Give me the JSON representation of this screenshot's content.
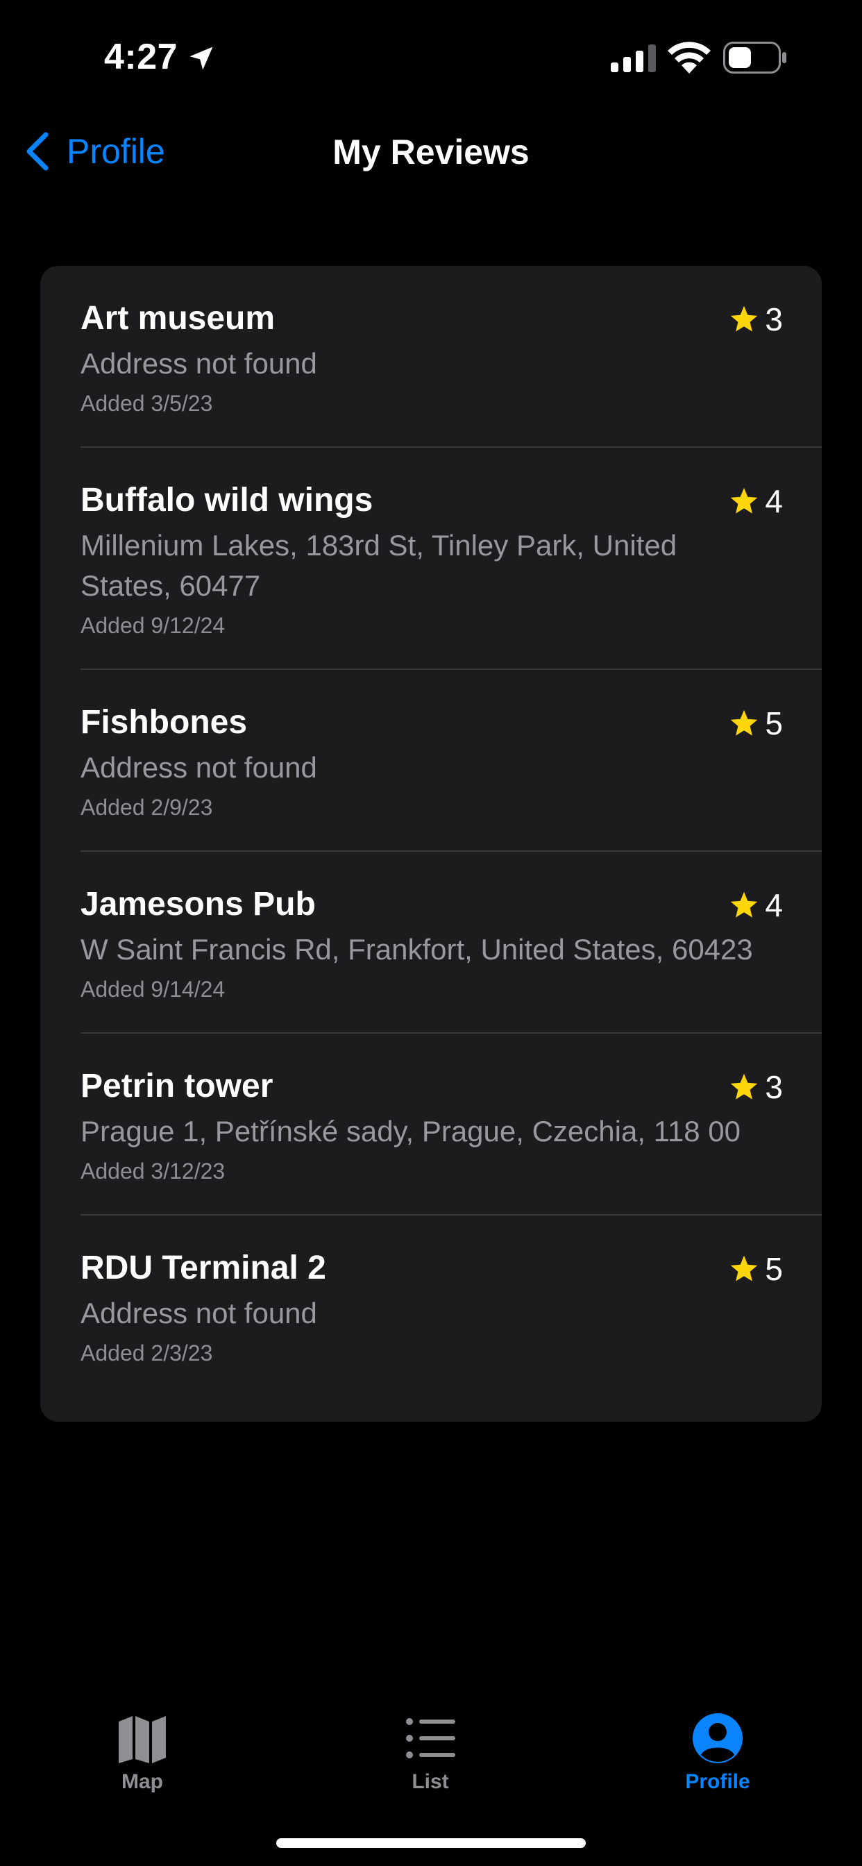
{
  "status_bar": {
    "time": "4:27",
    "icons": [
      "location-arrow-icon",
      "cellular-signal-icon",
      "wifi-icon",
      "battery-icon"
    ]
  },
  "nav": {
    "back_label": "Profile",
    "title": "My Reviews"
  },
  "colors": {
    "accent": "#0a84ff",
    "star": "#ffd60a",
    "card_bg": "#1c1c1e",
    "secondary_text": "#98989f"
  },
  "reviews": [
    {
      "name": "Art museum",
      "address": "Address not found",
      "date": "Added 3/5/23",
      "rating": "3"
    },
    {
      "name": "Buffalo wild wings",
      "address": "Millenium Lakes, 183rd St, Tinley Park, United States, 60477",
      "date": "Added 9/12/24",
      "rating": "4"
    },
    {
      "name": "Fishbones",
      "address": "Address not found",
      "date": "Added 2/9/23",
      "rating": "5"
    },
    {
      "name": "Jamesons Pub",
      "address": "W Saint Francis Rd, Frankfort, United States, 60423",
      "date": "Added 9/14/24",
      "rating": "4"
    },
    {
      "name": "Petrin tower",
      "address": "Prague 1, Petřínské sady, Prague, Czechia, 118 00",
      "date": "Added 3/12/23",
      "rating": "3"
    },
    {
      "name": "RDU Terminal 2",
      "address": "Address not found",
      "date": "Added 2/3/23",
      "rating": "5"
    }
  ],
  "tabs": [
    {
      "label": "Map",
      "icon": "map-icon",
      "active": false
    },
    {
      "label": "List",
      "icon": "list-icon",
      "active": false
    },
    {
      "label": "Profile",
      "icon": "profile-icon",
      "active": true
    }
  ]
}
